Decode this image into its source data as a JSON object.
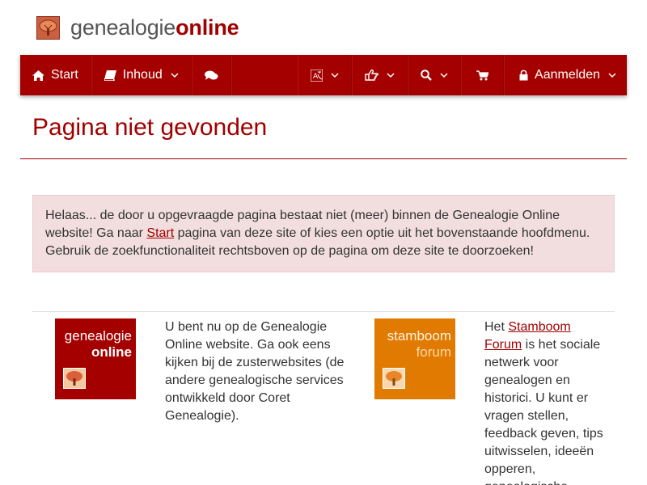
{
  "brand": {
    "name_part1": "genealogie",
    "name_part2": "online",
    "logo_icon": "tree-icon"
  },
  "navbar": {
    "start_label": "Start",
    "inhoud_label": "Inhoud",
    "aanmelden_label": "Aanmelden",
    "icons": [
      "home-icon",
      "book-icon",
      "chat-icon",
      "language-icon",
      "thumbs-up-icon",
      "search-icon",
      "cart-icon",
      "lock-icon"
    ]
  },
  "page": {
    "title": "Pagina niet gevonden"
  },
  "alert": {
    "text_before": "Helaas... de door u opgevraagde pagina bestaat niet (meer) binnen de Genealogie Online website! Ga naar ",
    "link_text": "Start",
    "text_after": " pagina van deze site of kies een optie uit het bovenstaande hoofdmenu. Gebruik de zoekfunctionaliteit rechtsboven op de pagina om deze site te doorzoeken!"
  },
  "sites": {
    "genealogie_online": {
      "tile_line1": "genealogie",
      "tile_line2": "online",
      "description": "U bent nu op de Genealogie Online website. Ga ook eens kijken bij de zusterwebsites (de andere genealogische services ontwikkeld door Coret Genealogie)."
    },
    "stamboom_forum": {
      "tile_line1": "stamboom",
      "tile_line2": "forum",
      "text_before": "Het ",
      "link_text": "Stamboom Forum",
      "text_after": " is het sociale netwerk voor genealogen en historici. U kunt er vragen stellen, feedback geven, tips uitwisselen, ideeën opperen, genealogische"
    }
  },
  "colors": {
    "brand_red": "#a40000",
    "alert_bg": "#f2dede",
    "forum_orange": "#e07a00"
  }
}
